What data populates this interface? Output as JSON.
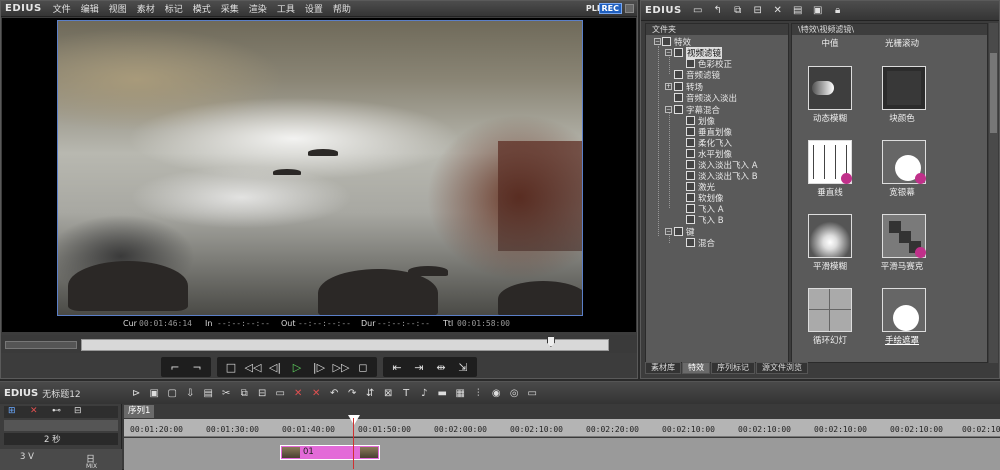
{
  "app": {
    "logo": "EDIUS",
    "menu": [
      "文件",
      "编辑",
      "视图",
      "素材",
      "标记",
      "模式",
      "采集",
      "渲染",
      "工具",
      "设置",
      "帮助"
    ],
    "plr": "PLR",
    "rec": "REC"
  },
  "player": {
    "timecodes": {
      "cur_label": "Cur",
      "cur_value": "00:01:46:14",
      "in_label": "In",
      "in_value": "--:--:--:--",
      "out_label": "Out",
      "out_value": "--:--:--:--",
      "dur_label": "Dur",
      "dur_value": "--:--:--:--",
      "ttl_label": "Ttl",
      "ttl_value": "00:01:58:00"
    },
    "scrub_position": 0.89
  },
  "effects": {
    "title": "EDIUS",
    "tree_header": "文件夹",
    "path": "\\特效\\视频滤镜\\",
    "tree": [
      {
        "label": "特效"
      },
      {
        "label": "视频滤镜"
      },
      {
        "label": "色彩校正"
      },
      {
        "label": "音频滤镜"
      },
      {
        "label": "转场"
      },
      {
        "label": "音频淡入淡出"
      },
      {
        "label": "字幕混合"
      },
      {
        "label": "划像"
      },
      {
        "label": "垂直划像"
      },
      {
        "label": "柔化飞入"
      },
      {
        "label": "水平划像"
      },
      {
        "label": "淡入淡出飞入 A"
      },
      {
        "label": "淡入淡出飞入 B"
      },
      {
        "label": "激光"
      },
      {
        "label": "软划像"
      },
      {
        "label": "飞入 A"
      },
      {
        "label": "飞入 B"
      },
      {
        "label": "键"
      },
      {
        "label": "混合"
      }
    ],
    "top_labels": [
      "中值",
      "光栅滚动"
    ],
    "tiles": [
      {
        "label": "动态模糊"
      },
      {
        "label": "块颜色"
      },
      {
        "label": "垂直线"
      },
      {
        "label": "宽银幕"
      },
      {
        "label": "平滑模糊"
      },
      {
        "label": "平滑马赛克"
      },
      {
        "label": "循环幻灯"
      },
      {
        "label": "手绘遮罩"
      }
    ],
    "tabs": [
      "素材库",
      "特效",
      "序列标记",
      "源文件浏览"
    ]
  },
  "timeline": {
    "logo": "EDIUS",
    "project": "无标题12",
    "sequence_tab": "序列1",
    "zoom": "2 秒",
    "track_name": "3 V",
    "track_mix": "MIX",
    "ruler": [
      "00:01:20:00",
      "00:01:30:00",
      "00:01:40:00",
      "00:01:50:00",
      "00:02:00:00",
      "00:02:10:00",
      "00:02:20:00",
      "00:02:10:00",
      "00:02:10:00",
      "00:02:10:00",
      "00:02:10:00",
      "00:02:10:00"
    ],
    "clip_label": "01"
  }
}
